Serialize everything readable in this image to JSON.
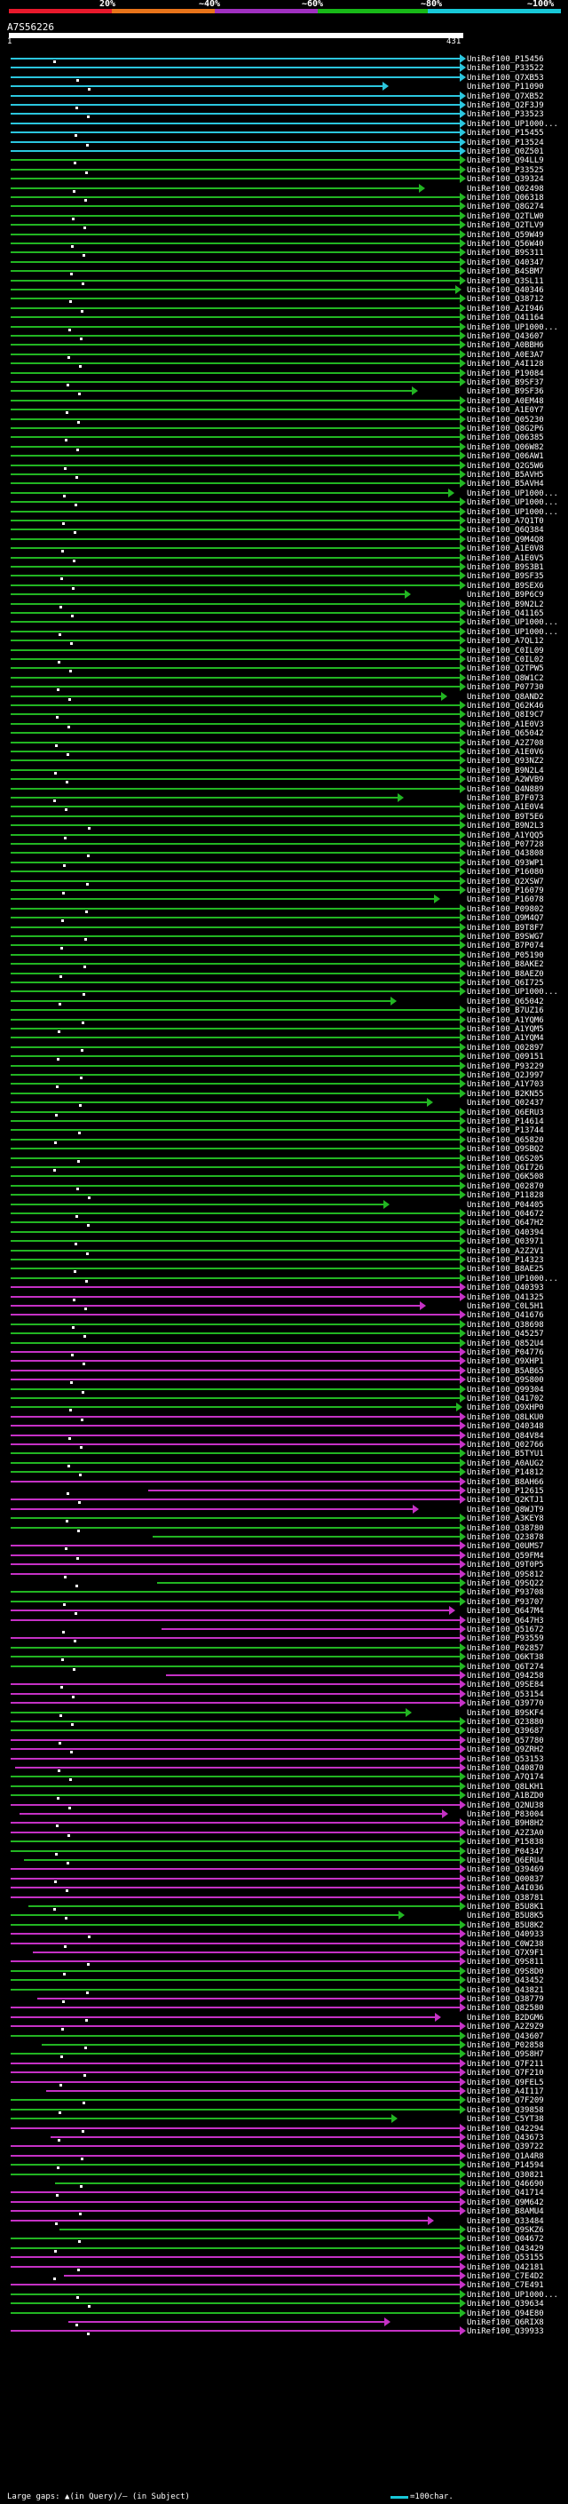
{
  "legend": {
    "labels": [
      "20%",
      "~40%",
      "~60%",
      "~80%",
      "~100%"
    ],
    "colors": [
      "#e8192c",
      "#e8741a",
      "#a030c0",
      "#18b818",
      "#18c8d8"
    ]
  },
  "query": {
    "id": "A7S56226",
    "start": "1",
    "end": "431"
  },
  "hit_colors": {
    "cyan": "#2bc6de",
    "green": "#22b522",
    "magenta": "#c531c5"
  },
  "hits": [
    "UniRef100_P15456",
    "UniRef100_P33522",
    "UniRef100_Q7XB53",
    "UniRef100_P11090",
    "UniRef100_Q7XB52",
    "UniRef100_Q2F3J9",
    "UniRef100_P33523",
    "UniRef100_UP1000...",
    "UniRef100_P15455",
    "UniRef100_P13524",
    "UniRef100_Q0Z501",
    "UniRef100_Q94LL9",
    "UniRef100_P33525",
    "UniRef100_Q39324",
    "UniRef100_Q02498",
    "UniRef100_Q06318",
    "UniRef100_Q8G274",
    "UniRef100_Q2TLW0",
    "UniRef100_Q2TLV9",
    "UniRef100_Q59W49",
    "UniRef100_Q56W40",
    "UniRef100_B9S311",
    "UniRef100_Q40347",
    "UniRef100_B4SBM7",
    "UniRef100_Q3SL11",
    "UniRef100_Q40346",
    "UniRef100_Q38712",
    "UniRef100_A2I946",
    "UniRef100_Q41164",
    "UniRef100_UP1000...",
    "UniRef100_Q43607",
    "UniRef100_A0BBH6",
    "UniRef100_A0E3A7",
    "UniRef100_A4I128",
    "UniRef100_P19084",
    "UniRef100_B9SF37",
    "UniRef100_B9SF36",
    "UniRef100_A0EM48",
    "UniRef100_A1E0Y7",
    "UniRef100_Q05230",
    "UniRef100_Q8G2P6",
    "UniRef100_Q06385",
    "UniRef100_Q06W82",
    "UniRef100_Q06AW1",
    "UniRef100_Q2G5W6",
    "UniRef100_B5AVH5",
    "UniRef100_B5AVH4",
    "UniRef100_UP1000...",
    "UniRef100_UP1000...",
    "UniRef100_UP1000...",
    "UniRef100_A7Q1T0",
    "UniRef100_Q6Q384",
    "UniRef100_Q9M4Q8",
    "UniRef100_A1E0V8",
    "UniRef100_A1E0V5",
    "UniRef100_B9S3B1",
    "UniRef100_B9SF35",
    "UniRef100_B9SEX6",
    "UniRef100_B9P6C9",
    "UniRef100_B9N2L2",
    "UniRef100_Q41165",
    "UniRef100_UP1000...",
    "UniRef100_UP1000...",
    "UniRef100_A7QL12",
    "UniRef100_C0IL09",
    "UniRef100_C0IL02",
    "UniRef100_Q2TPW5",
    "UniRef100_Q8W1C2",
    "UniRef100_P07730",
    "UniRef100_Q8AND2",
    "UniRef100_Q62K46",
    "UniRef100_Q8I9C7",
    "UniRef100_A1E0V3",
    "UniRef100_Q65042",
    "UniRef100_A2Z708",
    "UniRef100_A1E0V6",
    "UniRef100_Q93NZ2",
    "UniRef100_B9N2L4",
    "UniRef100_A2WVB9",
    "UniRef100_Q4N889",
    "UniRef100_B7F073",
    "UniRef100_A1E0V4",
    "UniRef100_B9T5E6",
    "UniRef100_B9N2L3",
    "UniRef100_A1YQQ5",
    "UniRef100_P07728",
    "UniRef100_Q43808",
    "UniRef100_Q93WP1",
    "UniRef100_P16080",
    "UniRef100_Q2XSW7",
    "UniRef100_P16079",
    "UniRef100_P16078",
    "UniRef100_P09802",
    "UniRef100_Q9M4Q7",
    "UniRef100_B9T8F7",
    "UniRef100_B9SWG7",
    "UniRef100_B7P074",
    "UniRef100_P05190",
    "UniRef100_B8AKE2",
    "UniRef100_B8AEZ0",
    "UniRef100_Q6I725",
    "UniRef100_UP1000...",
    "UniRef100_Q65042",
    "UniRef100_B7UZ16",
    "UniRef100_A1YQM6",
    "UniRef100_A1YQM5",
    "UniRef100_A1YQM4",
    "UniRef100_Q02897",
    "UniRef100_Q09151",
    "UniRef100_P93229",
    "UniRef100_Q2J997",
    "UniRef100_A1Y703",
    "UniRef100_B2KN55",
    "UniRef100_Q02437",
    "UniRef100_Q6ERU3",
    "UniRef100_P14614",
    "UniRef100_P13744",
    "UniRef100_Q65820",
    "UniRef100_Q9SBQ2",
    "UniRef100_Q6S205",
    "UniRef100_Q6I726",
    "UniRef100_Q6K508",
    "UniRef100_Q02870",
    "UniRef100_P11828",
    "UniRef100_P04405",
    "UniRef100_Q04672",
    "UniRef100_Q647H2",
    "UniRef100_Q40394",
    "UniRef100_Q03971",
    "UniRef100_A2Z2V1",
    "UniRef100_P14323",
    "UniRef100_B8AE25",
    "UniRef100_UP1000...",
    "UniRef100_Q40393",
    "UniRef100_Q41325",
    "UniRef100_C0L5H1",
    "UniRef100_Q41676",
    "UniRef100_Q38698",
    "UniRef100_Q45257",
    "UniRef100_Q852U4",
    "UniRef100_P04776",
    "UniRef100_Q9XHP1",
    "UniRef100_B5AB65",
    "UniRef100_Q9S800",
    "UniRef100_Q99304",
    "UniRef100_Q41702",
    "UniRef100_Q9XHP0",
    "UniRef100_Q8LKU0",
    "UniRef100_Q40348",
    "UniRef100_Q84V84",
    "UniRef100_Q02766",
    "UniRef100_B5TYU1",
    "UniRef100_A0AUG2",
    "UniRef100_P14812",
    "UniRef100_B8AH66",
    "UniRef100_P12615",
    "UniRef100_Q2KTJ1",
    "UniRef100_Q8WJT9",
    "UniRef100_A3KEY8",
    "UniRef100_Q38780",
    "UniRef100_Q23878",
    "UniRef100_Q0UMS7",
    "UniRef100_Q59FM4",
    "UniRef100_Q9T0P5",
    "UniRef100_Q9S812",
    "UniRef100_Q9SQ22",
    "UniRef100_P93708",
    "UniRef100_P93707",
    "UniRef100_Q647M4",
    "UniRef100_Q647H3",
    "UniRef100_Q51672",
    "UniRef100_P93559",
    "UniRef100_P02857",
    "UniRef100_Q6KT38",
    "UniRef100_Q6T274",
    "UniRef100_Q94258",
    "UniRef100_Q9SE84",
    "UniRef100_Q53154",
    "UniRef100_Q39770",
    "UniRef100_B9SKF4",
    "UniRef100_Q23880",
    "UniRef100_Q39687",
    "UniRef100_Q57780",
    "UniRef100_Q9ZRH2",
    "UniRef100_Q53153",
    "UniRef100_Q40870",
    "UniRef100_A7Q174",
    "UniRef100_Q8LKH1",
    "UniRef100_A1BZD0",
    "UniRef100_Q2NU38",
    "UniRef100_P83004",
    "UniRef100_B9H8H2",
    "UniRef100_A2Z3A0",
    "UniRef100_P15838",
    "UniRef100_P04347",
    "UniRef100_Q6ERU4",
    "UniRef100_Q39469",
    "UniRef100_Q00837",
    "UniRef100_A4I036",
    "UniRef100_Q38781",
    "UniRef100_B5U8K1",
    "UniRef100_B5U8K5",
    "UniRef100_B5U8K2",
    "UniRef100_Q40933",
    "UniRef100_C0W238",
    "UniRef100_Q7X9F1",
    "UniRef100_Q9S811",
    "UniRef100_Q9S8D0",
    "UniRef100_Q43452",
    "UniRef100_Q43821",
    "UniRef100_Q38779",
    "UniRef100_Q82580",
    "UniRef100_B2DGM6",
    "UniRef100_A2Z9Z9",
    "UniRef100_Q43607",
    "UniRef100_P02858",
    "UniRef100_Q9S8H7",
    "UniRef100_Q7F211",
    "UniRef100_Q7F210",
    "UniRef100_Q9FEL5",
    "UniRef100_A4I117",
    "UniRef100_Q7F209",
    "UniRef100_Q39858",
    "UniRef100_C5YT38",
    "UniRef100_Q42294",
    "UniRef100_Q43673",
    "UniRef100_Q39722",
    "UniRef100_Q1A4R8",
    "UniRef100_P14594",
    "UniRef100_Q30821",
    "UniRef100_Q46690",
    "UniRef100_Q41714",
    "UniRef100_Q9M642",
    "UniRef100_B8AMU4",
    "UniRef100_Q33484",
    "UniRef100_Q9SKZ6",
    "UniRef100_Q04672",
    "UniRef100_Q43429",
    "UniRef100_Q53155",
    "UniRef100_Q42181",
    "UniRef100_C7E4D2",
    "UniRef100_C7E491",
    "UniRef100_UP1000...",
    "UniRef100_Q39634",
    "UniRef100_Q94E80",
    "UniRef100_Q6RIX8",
    "UniRef100_Q39933"
  ],
  "footer": {
    "gaps_text": "Large gaps: ▲(in Query)/– (in Subject)",
    "scale_text": "=100char."
  }
}
